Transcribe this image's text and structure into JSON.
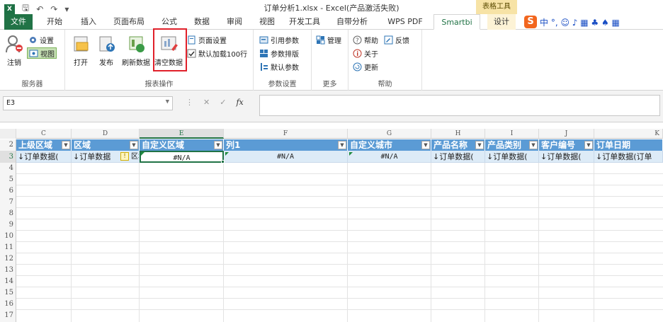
{
  "titlebar": {
    "title": "订单分析1.xlsx - Excel(产品激活失败)",
    "context_group": "表格工具"
  },
  "tabs": [
    "文件",
    "开始",
    "插入",
    "页面布局",
    "公式",
    "数据",
    "审阅",
    "视图",
    "开发工具",
    "自带分析",
    "WPS PDF",
    "Smartbi",
    "设计"
  ],
  "ime": {
    "logo": "S",
    "items": "中 °, ☺ ♪ ▦ ♣ ♠ ▦"
  },
  "ribbon": {
    "groups": {
      "server": "服务器",
      "report": "报表操作",
      "params": "参数设置",
      "more": "更多",
      "help": "帮助"
    },
    "buttons": {
      "logout": "注销",
      "settings": "设置",
      "view": "视图",
      "open": "打开",
      "publish": "发布",
      "refresh": "刷新数据",
      "clear": "清空数据",
      "page_setup": "页面设置",
      "load100": "默认加载100行",
      "ref_params": "引用参数",
      "param_layout": "参数排版",
      "default_params": "默认参数",
      "manage": "管理",
      "help": "帮助",
      "feedback": "反馈",
      "about": "关于",
      "update": "更新"
    }
  },
  "formula_bar": {
    "name_box": "E3",
    "fx": "fx",
    "value": ""
  },
  "sheet": {
    "columns": [
      "C",
      "D",
      "E",
      "F",
      "G",
      "H",
      "I",
      "J",
      "K"
    ],
    "row_numbers": [
      "2",
      "3",
      "4",
      "5",
      "6",
      "7",
      "8",
      "9",
      "10",
      "11",
      "12",
      "13",
      "14",
      "15",
      "16",
      "17"
    ],
    "headers": [
      "上级区域",
      "区域",
      "自定义区域",
      "列1",
      "自定义城市",
      "产品名称",
      "产品类别",
      "客户编号",
      "订单日期"
    ],
    "row3": [
      "↓订单数据(",
      "↓订单数据",
      "#N/A",
      "#N/A",
      "#N/A",
      "↓订单数据(",
      "↓订单数据(",
      "↓订单数据(",
      "↓订单数据(订单"
    ],
    "warn_text": "区址"
  }
}
